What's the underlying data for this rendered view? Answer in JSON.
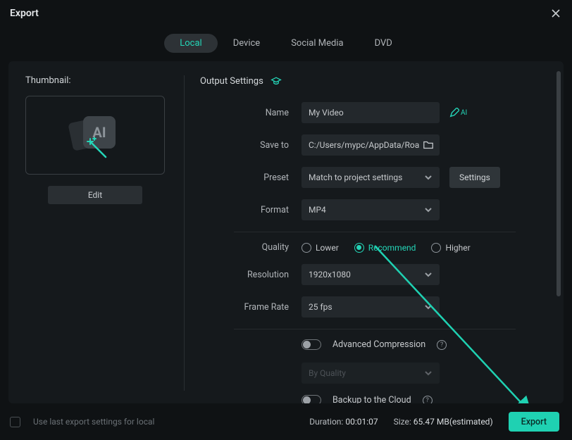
{
  "window": {
    "title": "Export"
  },
  "tabs": [
    {
      "label": "Local",
      "active": true
    },
    {
      "label": "Device",
      "active": false
    },
    {
      "label": "Social Media",
      "active": false
    },
    {
      "label": "DVD",
      "active": false
    }
  ],
  "thumbnail": {
    "label": "Thumbnail:",
    "edit_label": "Edit"
  },
  "output": {
    "header": "Output Settings",
    "name_label": "Name",
    "name_value": "My Video",
    "ai_label": "AI",
    "saveto_label": "Save to",
    "saveto_value": "C:/Users/mypc/AppData/Roar",
    "preset_label": "Preset",
    "preset_value": "Match to project settings",
    "settings_label": "Settings",
    "format_label": "Format",
    "format_value": "MP4",
    "quality_label": "Quality",
    "quality_options": {
      "lower": "Lower",
      "recommend": "Recommend",
      "higher": "Higher"
    },
    "resolution_label": "Resolution",
    "resolution_value": "1920x1080",
    "framerate_label": "Frame Rate",
    "framerate_value": "25 fps",
    "advanced_label": "Advanced Compression",
    "advanced_mode_value": "By Quality",
    "backup_label": "Backup to the Cloud"
  },
  "footer": {
    "use_last_label": "Use last export settings for local",
    "duration_label": "Duration:",
    "duration_value": "00:01:07",
    "size_label": "Size:",
    "size_value": "65.47 MB(estimated)",
    "export_label": "Export"
  }
}
